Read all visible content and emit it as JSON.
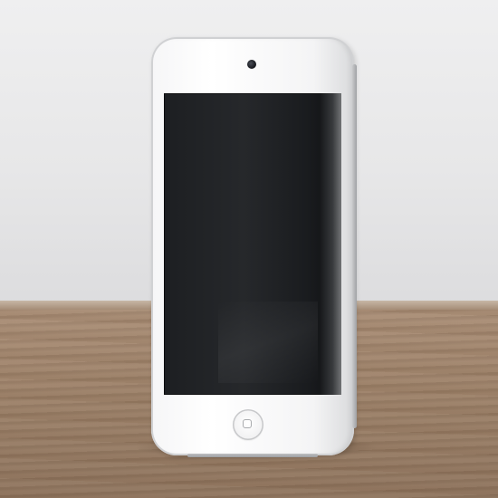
{
  "scene": {
    "subject": "media-player-device",
    "device_color": "#f5f5f6",
    "screen_state": "off",
    "screen_color": "#1d1f22",
    "wall_color": "#e9e9ea",
    "table_color": "#9d8168"
  },
  "icons": {
    "camera": "camera-icon",
    "home_button": "home-button-icon"
  }
}
